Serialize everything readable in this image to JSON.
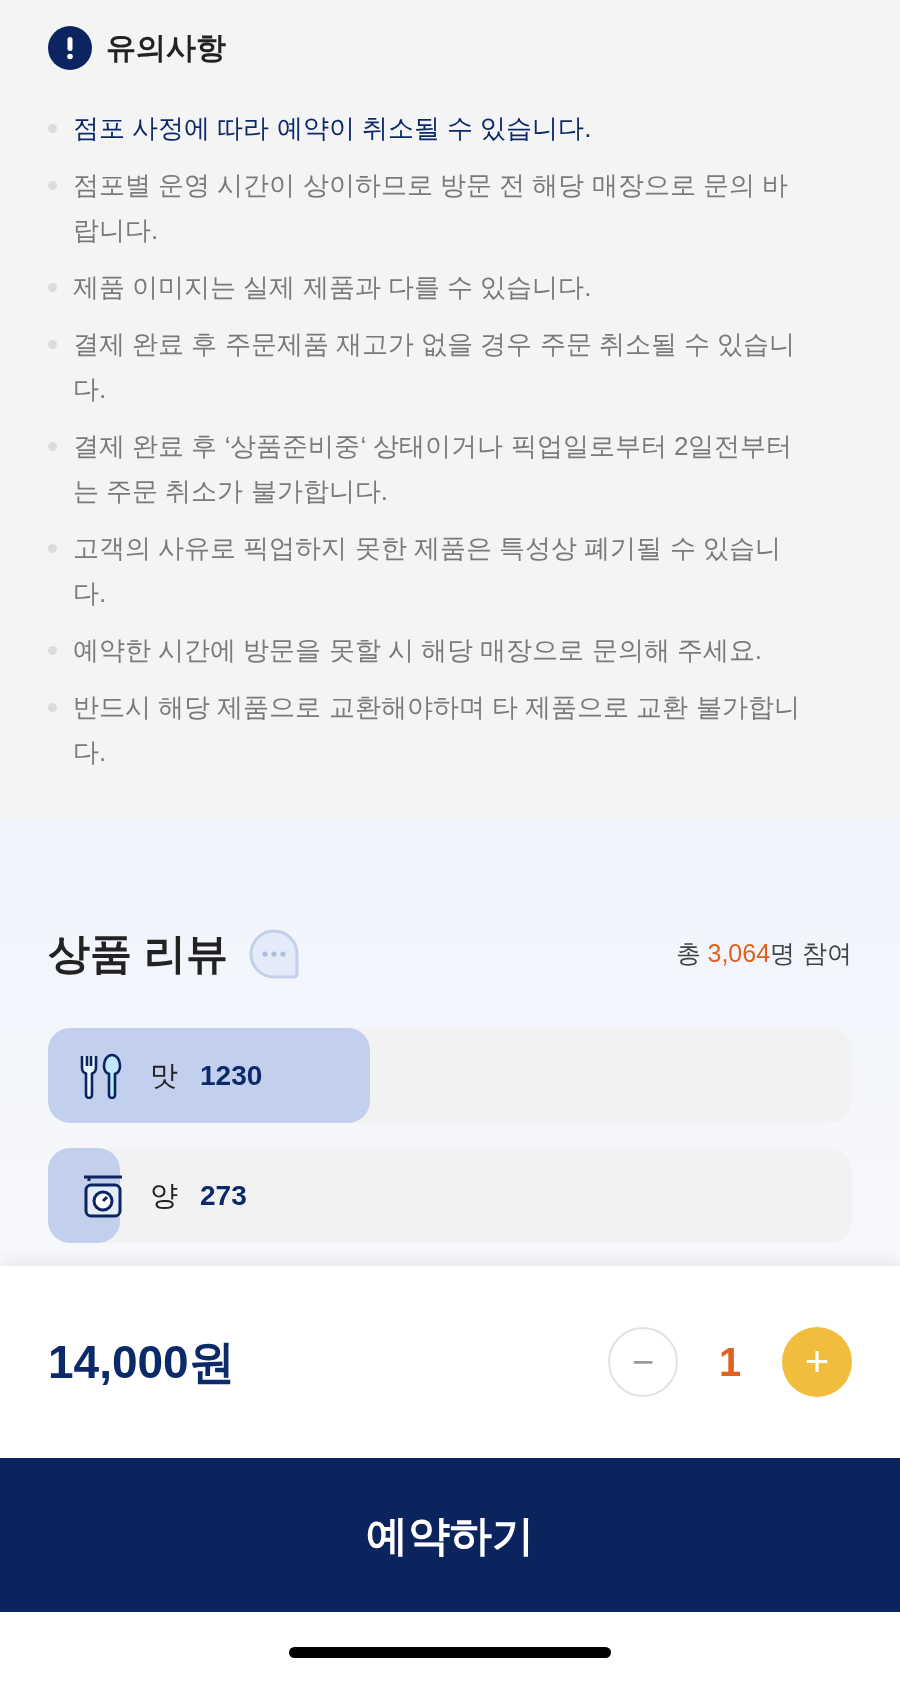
{
  "notice": {
    "title": "유의사항",
    "items": [
      {
        "text": "점포 사정에 따라 예약이 취소될 수 있습니다.",
        "highlighted": true
      },
      {
        "text": "점포별 운영 시간이 상이하므로 방문 전 해당 매장으로 문의 바랍니다.",
        "highlighted": false
      },
      {
        "text": "제품 이미지는 실제 제품과 다를 수 있습니다.",
        "highlighted": false
      },
      {
        "text": "결제 완료 후 주문제품 재고가 없을 경우 주문 취소될 수 있습니다.",
        "highlighted": false
      },
      {
        "text": "결제 완료 후 ‘상품준비중‘ 상태이거나 픽업일로부터 2일전부터는 주문 취소가 불가합니다.",
        "highlighted": false
      },
      {
        "text": "고객의 사유로 픽업하지 못한 제품은 특성상 폐기될 수 있습니다.",
        "highlighted": false
      },
      {
        "text": "예약한 시간에 방문을 못할 시 해당 매장으로 문의해 주세요.",
        "highlighted": false
      },
      {
        "text": "반드시 해당 제품으로 교환해야하며 타 제품으로 교환 불가합니다.",
        "highlighted": false
      }
    ]
  },
  "reviews": {
    "title": "상품 리뷰",
    "total_prefix": "총",
    "total_count": "3,064",
    "total_suffix": "명 참여",
    "bars": [
      {
        "kind": "taste",
        "label": "맛",
        "count": "1230",
        "level": 0.4
      },
      {
        "kind": "amount",
        "label": "양",
        "count": "273",
        "level": 0.09
      }
    ]
  },
  "order": {
    "price": "14,000원",
    "minus": "−",
    "quantity": "1",
    "plus": "+",
    "button": "예약하기"
  }
}
